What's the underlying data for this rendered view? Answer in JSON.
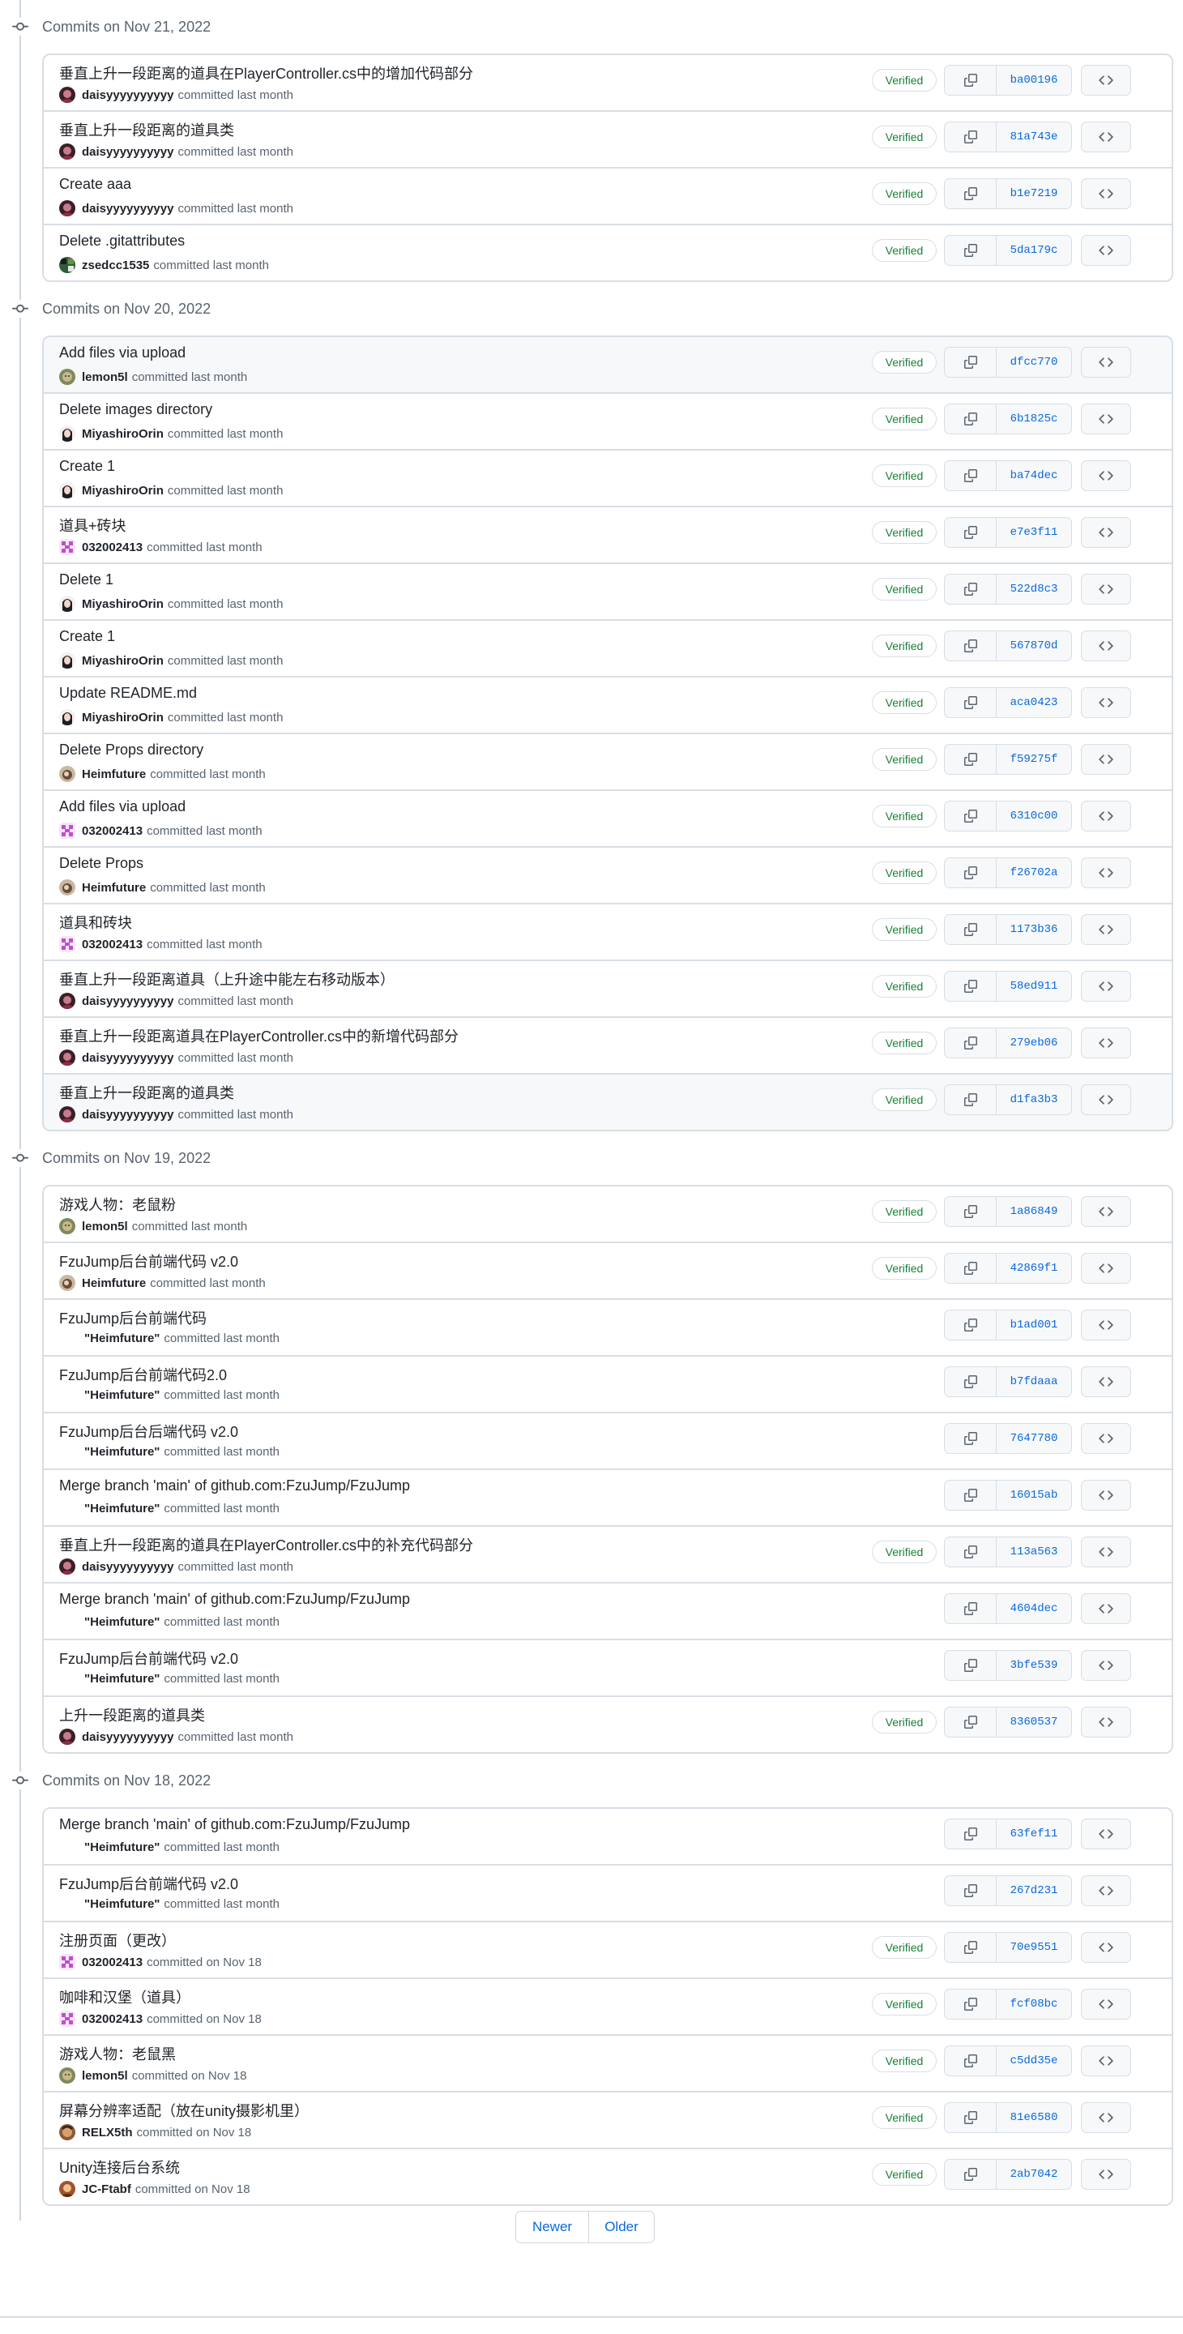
{
  "groups": [
    {
      "title": "Commits on Nov 21, 2022",
      "commits": [
        {
          "message": "垂直上升一段距离的道具在PlayerController.cs中的增加代码部分",
          "author": "daisyyyyyyyyyy",
          "time": "committed last month",
          "verified": true,
          "sha": "ba00196",
          "avatar": "daisy",
          "hl": false
        },
        {
          "message": "垂直上升一段距离的道具类",
          "author": "daisyyyyyyyyyy",
          "time": "committed last month",
          "verified": true,
          "sha": "81a743e",
          "avatar": "daisy",
          "hl": false
        },
        {
          "message": "Create aaa",
          "author": "daisyyyyyyyyyy",
          "time": "committed last month",
          "verified": true,
          "sha": "b1e7219",
          "avatar": "daisy",
          "hl": false
        },
        {
          "message": "Delete .gitattributes",
          "author": "zsedcc1535",
          "time": "committed last month",
          "verified": true,
          "sha": "5da179c",
          "avatar": "zsedcc",
          "hl": false
        }
      ]
    },
    {
      "title": "Commits on Nov 20, 2022",
      "commits": [
        {
          "message": "Add files via upload",
          "author": "lemon5l",
          "time": "committed last month",
          "verified": true,
          "sha": "dfcc770",
          "avatar": "lemon",
          "hl": true
        },
        {
          "message": "Delete images directory",
          "author": "MiyashiroOrin",
          "time": "committed last month",
          "verified": true,
          "sha": "6b1825c",
          "avatar": "miya",
          "hl": false
        },
        {
          "message": "Create 1",
          "author": "MiyashiroOrin",
          "time": "committed last month",
          "verified": true,
          "sha": "ba74dec",
          "avatar": "miya",
          "hl": false
        },
        {
          "message": "道具+砖块",
          "author": "032002413",
          "time": "committed last month",
          "verified": true,
          "sha": "e7e3f11",
          "avatar": "pink",
          "hl": false
        },
        {
          "message": "Delete 1",
          "author": "MiyashiroOrin",
          "time": "committed last month",
          "verified": true,
          "sha": "522d8c3",
          "avatar": "miya",
          "hl": false
        },
        {
          "message": "Create 1",
          "author": "MiyashiroOrin",
          "time": "committed last month",
          "verified": true,
          "sha": "567870d",
          "avatar": "miya",
          "hl": false
        },
        {
          "message": "Update README.md",
          "author": "MiyashiroOrin",
          "time": "committed last month",
          "verified": true,
          "sha": "aca0423",
          "avatar": "miya",
          "hl": false
        },
        {
          "message": "Delete Props directory",
          "author": "Heimfuture",
          "time": "committed last month",
          "verified": true,
          "sha": "f59275f",
          "avatar": "heim",
          "hl": false
        },
        {
          "message": "Add files via upload",
          "author": "032002413",
          "time": "committed last month",
          "verified": true,
          "sha": "6310c00",
          "avatar": "pink",
          "hl": false
        },
        {
          "message": "Delete Props",
          "author": "Heimfuture",
          "time": "committed last month",
          "verified": true,
          "sha": "f26702a",
          "avatar": "heim",
          "hl": false
        },
        {
          "message": "道具和砖块",
          "author": "032002413",
          "time": "committed last month",
          "verified": true,
          "sha": "1173b36",
          "avatar": "pink",
          "hl": false
        },
        {
          "message": "垂直上升一段距离道具（上升途中能左右移动版本）",
          "author": "daisyyyyyyyyyy",
          "time": "committed last month",
          "verified": true,
          "sha": "58ed911",
          "avatar": "daisy",
          "hl": false
        },
        {
          "message": "垂直上升一段距离道具在PlayerController.cs中的新增代码部分",
          "author": "daisyyyyyyyyyy",
          "time": "committed last month",
          "verified": true,
          "sha": "279eb06",
          "avatar": "daisy",
          "hl": false
        },
        {
          "message": "垂直上升一段距离的道具类",
          "author": "daisyyyyyyyyyy",
          "time": "committed last month",
          "verified": true,
          "sha": "d1fa3b3",
          "avatar": "daisy",
          "hl": true
        }
      ]
    },
    {
      "title": "Commits on Nov 19, 2022",
      "commits": [
        {
          "message": "游戏人物：老鼠粉",
          "author": "lemon5l",
          "time": "committed last month",
          "verified": true,
          "sha": "1a86849",
          "avatar": "lemon",
          "hl": false
        },
        {
          "message": "FzuJump后台前端代码 v2.0",
          "author": "Heimfuture",
          "time": "committed last month",
          "verified": true,
          "sha": "42869f1",
          "avatar": "heim",
          "hl": false
        },
        {
          "message": "FzuJump后台前端代码",
          "author": "\"Heimfuture\"",
          "time": "committed last month",
          "verified": false,
          "sha": "b1ad001",
          "avatar": "",
          "hl": false
        },
        {
          "message": "FzuJump后台前端代码2.0",
          "author": "\"Heimfuture\"",
          "time": "committed last month",
          "verified": false,
          "sha": "b7fdaaa",
          "avatar": "",
          "hl": false
        },
        {
          "message": "FzuJump后台后端代码 v2.0",
          "author": "\"Heimfuture\"",
          "time": "committed last month",
          "verified": false,
          "sha": "7647780",
          "avatar": "",
          "hl": false
        },
        {
          "message": "Merge branch 'main' of github.com:FzuJump/FzuJump",
          "author": "\"Heimfuture\"",
          "time": "committed last month",
          "verified": false,
          "sha": "16015ab",
          "avatar": "",
          "hl": false
        },
        {
          "message": "垂直上升一段距离的道具在PlayerController.cs中的补充代码部分",
          "author": "daisyyyyyyyyyy",
          "time": "committed last month",
          "verified": true,
          "sha": "113a563",
          "avatar": "daisy",
          "hl": false
        },
        {
          "message": "Merge branch 'main' of github.com:FzuJump/FzuJump",
          "author": "\"Heimfuture\"",
          "time": "committed last month",
          "verified": false,
          "sha": "4604dec",
          "avatar": "",
          "hl": false
        },
        {
          "message": "FzuJump后台前端代码 v2.0",
          "author": "\"Heimfuture\"",
          "time": "committed last month",
          "verified": false,
          "sha": "3bfe539",
          "avatar": "",
          "hl": false
        },
        {
          "message": "上升一段距离的道具类",
          "author": "daisyyyyyyyyyy",
          "time": "committed last month",
          "verified": true,
          "sha": "8360537",
          "avatar": "daisy",
          "hl": false
        }
      ]
    },
    {
      "title": "Commits on Nov 18, 2022",
      "commits": [
        {
          "message": "Merge branch 'main' of github.com:FzuJump/FzuJump",
          "author": "\"Heimfuture\"",
          "time": "committed last month",
          "verified": false,
          "sha": "63fef11",
          "avatar": "",
          "hl": false
        },
        {
          "message": "FzuJump后台前端代码 v2.0",
          "author": "\"Heimfuture\"",
          "time": "committed last month",
          "verified": false,
          "sha": "267d231",
          "avatar": "",
          "hl": false
        },
        {
          "message": "注册页面（更改）",
          "author": "032002413",
          "time": "committed on Nov 18",
          "verified": true,
          "sha": "70e9551",
          "avatar": "pink",
          "hl": false
        },
        {
          "message": "咖啡和汉堡（道具）",
          "author": "032002413",
          "time": "committed on Nov 18",
          "verified": true,
          "sha": "fcf08bc",
          "avatar": "pink",
          "hl": false
        },
        {
          "message": "游戏人物：老鼠黑",
          "author": "lemon5l",
          "time": "committed on Nov 18",
          "verified": true,
          "sha": "c5dd35e",
          "avatar": "lemon",
          "hl": false
        },
        {
          "message": "屏幕分辨率适配（放在unity摄影机里）",
          "author": "RELX5th",
          "time": "committed on Nov 18",
          "verified": true,
          "sha": "81e6580",
          "avatar": "relx",
          "hl": false
        },
        {
          "message": "Unity连接后台系统",
          "author": "JC-Ftabf",
          "time": "committed on Nov 18",
          "verified": true,
          "sha": "2ab7042",
          "avatar": "jc",
          "hl": false
        }
      ]
    }
  ],
  "labels": {
    "verified": "Verified",
    "newer": "Newer",
    "older": "Older"
  },
  "icons": {
    "timeline": "git-commit-icon",
    "copy": "copy-icon",
    "browse": "code-icon"
  },
  "colors": {
    "verified": "#1a7f37",
    "sha_link": "#0969da",
    "border": "#d8dee4",
    "muted": "#59636e"
  }
}
